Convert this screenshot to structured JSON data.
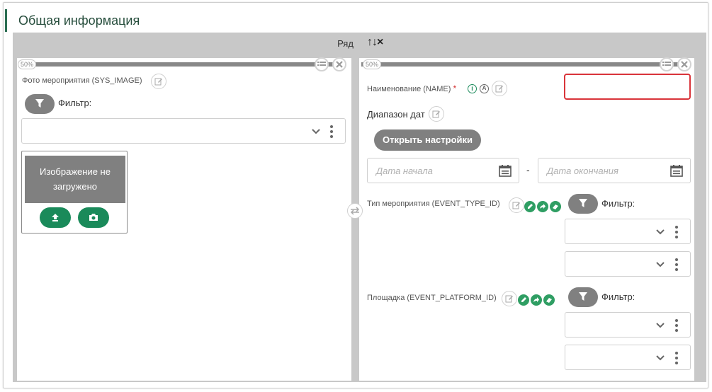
{
  "section": {
    "title": "Общая информация"
  },
  "row": {
    "label": "Ряд",
    "arrows": "↑↓×"
  },
  "left_column": {
    "width_badge": "50%",
    "image_field": {
      "label": "Фото мероприятия (SYS_IMAGE)",
      "filter_label": "Фильтр:",
      "placeholder_text": "Изображение не загружено"
    }
  },
  "right_column": {
    "width_badge": "50%",
    "name_field": {
      "label": "Наименование (NAME)",
      "required_mark": "*",
      "value": ""
    },
    "date_range": {
      "label": "Диапазон дат",
      "settings_button": "Открыть настройки",
      "start_placeholder": "Дата начала",
      "separator": "-",
      "end_placeholder": "Дата окончания"
    },
    "event_type": {
      "label": "Тип мероприятия (EVENT_TYPE_ID)",
      "filter_label": "Фильтр:"
    },
    "platform": {
      "label": "Площадка (EVENT_PLATFORM_ID)",
      "filter_label": "Фильтр:"
    }
  },
  "icons": {
    "info": "i",
    "auto": "A"
  },
  "colors": {
    "accent_green": "#1a8a5a",
    "title_green": "#264d3c",
    "required_red": "#d9343a",
    "gray_button": "#808080",
    "frame_gray": "#c8c8c8"
  }
}
